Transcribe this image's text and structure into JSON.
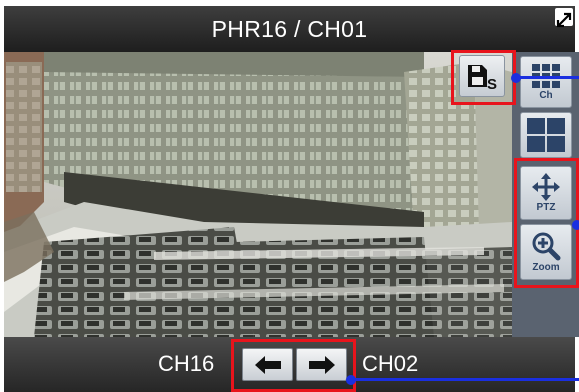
{
  "window": {
    "title": "PHR16 / CH01"
  },
  "toolbar": {
    "record_icon": "record-save-icon",
    "record_letter": "S",
    "ch_label": "Ch",
    "layout_icon": "quad-layout-icon",
    "ptz_label": "PTZ",
    "zoom_label": "Zoom"
  },
  "nav": {
    "prev_channel": "CH16",
    "next_channel": "CH02",
    "prev_icon": "arrow-left-icon",
    "next_icon": "arrow-right-icon"
  },
  "colors": {
    "highlight_box": "#e8141c",
    "callout_line": "#1a2fe0",
    "side_icon": "#2c4468"
  }
}
